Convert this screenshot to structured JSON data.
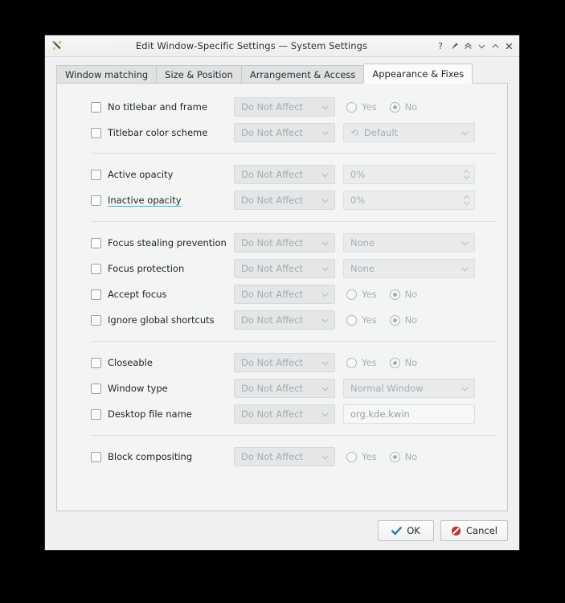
{
  "window": {
    "title": "Edit Window-Specific Settings — System Settings",
    "app_icon": "configure-tools-icon",
    "titlebar_buttons": [
      {
        "name": "help-button",
        "glyph": "?"
      },
      {
        "name": "keep-above-pin-button",
        "glyph": "pin"
      },
      {
        "name": "shade-button",
        "glyph": "double-chevron-up"
      },
      {
        "name": "minimize-button",
        "glyph": "chevron-down"
      },
      {
        "name": "maximize-button",
        "glyph": "chevron-up"
      },
      {
        "name": "close-button",
        "glyph": "×"
      }
    ]
  },
  "tabs": [
    {
      "label": "Window matching",
      "active": false
    },
    {
      "label": "Size & Position",
      "active": false
    },
    {
      "label": "Arrangement & Access",
      "active": false
    },
    {
      "label": "Appearance & Fixes",
      "active": true
    }
  ],
  "common": {
    "do_not_affect": "Do Not Affect",
    "yes": "Yes",
    "no": "No"
  },
  "groups": [
    {
      "name": "decoration-group",
      "rows": [
        {
          "name": "no-titlebar-and-frame",
          "label": "No titlebar and frame",
          "label_hover": false,
          "affect": "Do Not Affect",
          "control": "radio",
          "radio_selected": "No"
        },
        {
          "name": "titlebar-color-scheme",
          "label": "Titlebar color scheme",
          "label_hover": false,
          "affect": "Do Not Affect",
          "control": "combo-icon",
          "value": "Default",
          "icon": "revert-arrow-icon"
        }
      ]
    },
    {
      "name": "opacity-group",
      "rows": [
        {
          "name": "active-opacity",
          "label": "Active opacity",
          "label_hover": false,
          "affect": "Do Not Affect",
          "control": "spin",
          "value": "0%"
        },
        {
          "name": "inactive-opacity",
          "label": "Inactive opacity",
          "label_hover": true,
          "affect": "Do Not Affect",
          "control": "spin",
          "value": "0%"
        }
      ]
    },
    {
      "name": "focus-group",
      "rows": [
        {
          "name": "focus-stealing-prevention",
          "label": "Focus stealing prevention",
          "label_hover": false,
          "affect": "Do Not Affect",
          "control": "combo",
          "value": "None"
        },
        {
          "name": "focus-protection",
          "label": "Focus protection",
          "label_hover": false,
          "affect": "Do Not Affect",
          "control": "combo",
          "value": "None"
        },
        {
          "name": "accept-focus",
          "label": "Accept focus",
          "label_hover": false,
          "affect": "Do Not Affect",
          "control": "radio",
          "radio_selected": "No"
        },
        {
          "name": "ignore-global-shortcuts",
          "label": "Ignore global shortcuts",
          "label_hover": false,
          "affect": "Do Not Affect",
          "control": "radio",
          "radio_selected": "No"
        }
      ]
    },
    {
      "name": "window-behavior-group",
      "rows": [
        {
          "name": "closeable",
          "label": "Closeable",
          "label_hover": false,
          "affect": "Do Not Affect",
          "control": "radio",
          "radio_selected": "No"
        },
        {
          "name": "window-type",
          "label": "Window type",
          "label_hover": false,
          "affect": "Do Not Affect",
          "control": "combo",
          "value": "Normal Window"
        },
        {
          "name": "desktop-file-name",
          "label": "Desktop file name",
          "label_hover": false,
          "affect": "Do Not Affect",
          "control": "lineedit",
          "value": "org.kde.kwin"
        }
      ]
    },
    {
      "name": "compositing-group",
      "rows": [
        {
          "name": "block-compositing",
          "label": "Block compositing",
          "label_hover": false,
          "affect": "Do Not Affect",
          "control": "radio",
          "radio_selected": "No"
        }
      ]
    }
  ],
  "buttons": {
    "ok": {
      "label": "OK",
      "icon": "checkmark-icon",
      "color": "#2980b9"
    },
    "cancel": {
      "label": "Cancel",
      "icon": "cancel-circle-icon",
      "color": "#c0392b"
    }
  },
  "colors": {
    "window_bg": "#eff0f1",
    "panel_bg": "#f3f4f4",
    "accent": "#3daee9",
    "text": "#232629",
    "disabled_text": "#a9aeb2"
  }
}
